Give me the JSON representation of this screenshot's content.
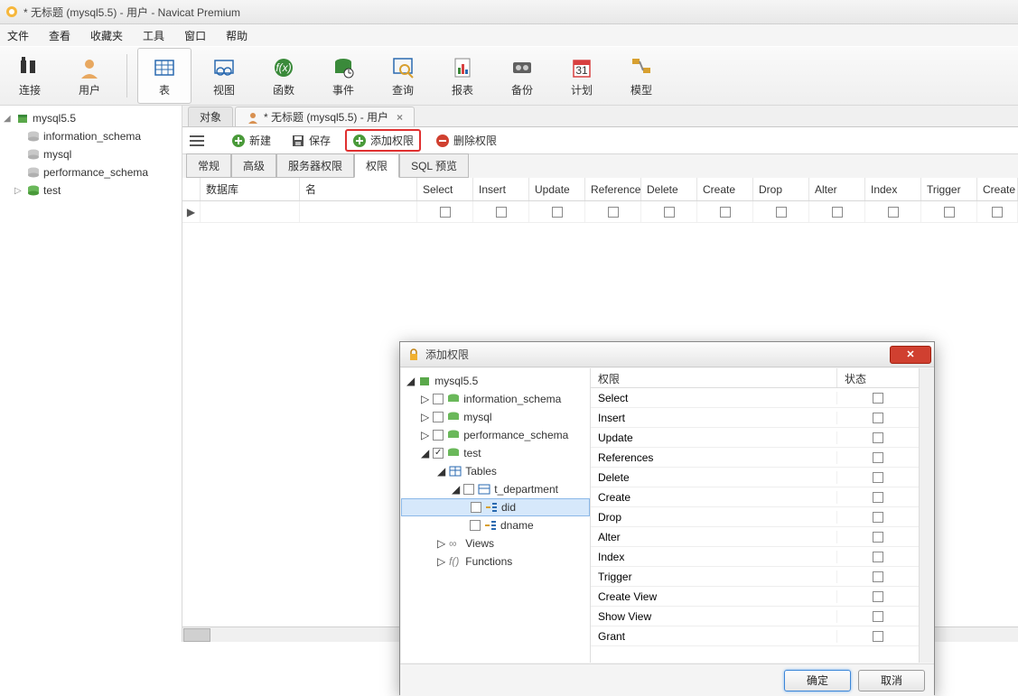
{
  "title": "* 无标题 (mysql5.5) - 用户 - Navicat Premium",
  "menu": [
    "文件",
    "查看",
    "收藏夹",
    "工具",
    "窗口",
    "帮助"
  ],
  "toolbar": [
    {
      "label": "连接"
    },
    {
      "label": "用户"
    },
    {
      "label": "表"
    },
    {
      "label": "视图"
    },
    {
      "label": "函数"
    },
    {
      "label": "事件"
    },
    {
      "label": "查询"
    },
    {
      "label": "报表"
    },
    {
      "label": "备份"
    },
    {
      "label": "计划"
    },
    {
      "label": "模型"
    }
  ],
  "sidebar": {
    "server": "mysql5.5",
    "dbs": [
      "information_schema",
      "mysql",
      "performance_schema",
      "test"
    ]
  },
  "doctabs": {
    "objects": "对象",
    "user": "* 无标题 (mysql5.5) - 用户"
  },
  "actions": {
    "new": "新建",
    "save": "保存",
    "add_priv": "添加权限",
    "del_priv": "删除权限"
  },
  "innertabs": [
    "常规",
    "高级",
    "服务器权限",
    "权限",
    "SQL 预览"
  ],
  "grid_headers": [
    "数据库",
    "名",
    "Select",
    "Insert",
    "Update",
    "Reference",
    "Delete",
    "Create",
    "Drop",
    "Alter",
    "Index",
    "Trigger",
    "Create"
  ],
  "dialog": {
    "title": "添加权限",
    "server": "mysql5.5",
    "dbs": [
      "information_schema",
      "mysql",
      "performance_schema",
      "test"
    ],
    "test_children": {
      "tables": "Tables",
      "views": "Views",
      "functions": "Functions"
    },
    "table": "t_department",
    "cols": [
      "did",
      "dname"
    ],
    "right_hdr": {
      "priv": "权限",
      "state": "状态"
    },
    "privs": [
      "Select",
      "Insert",
      "Update",
      "References",
      "Delete",
      "Create",
      "Drop",
      "Alter",
      "Index",
      "Trigger",
      "Create View",
      "Show View",
      "Grant"
    ],
    "ok": "确定",
    "cancel": "取消"
  }
}
